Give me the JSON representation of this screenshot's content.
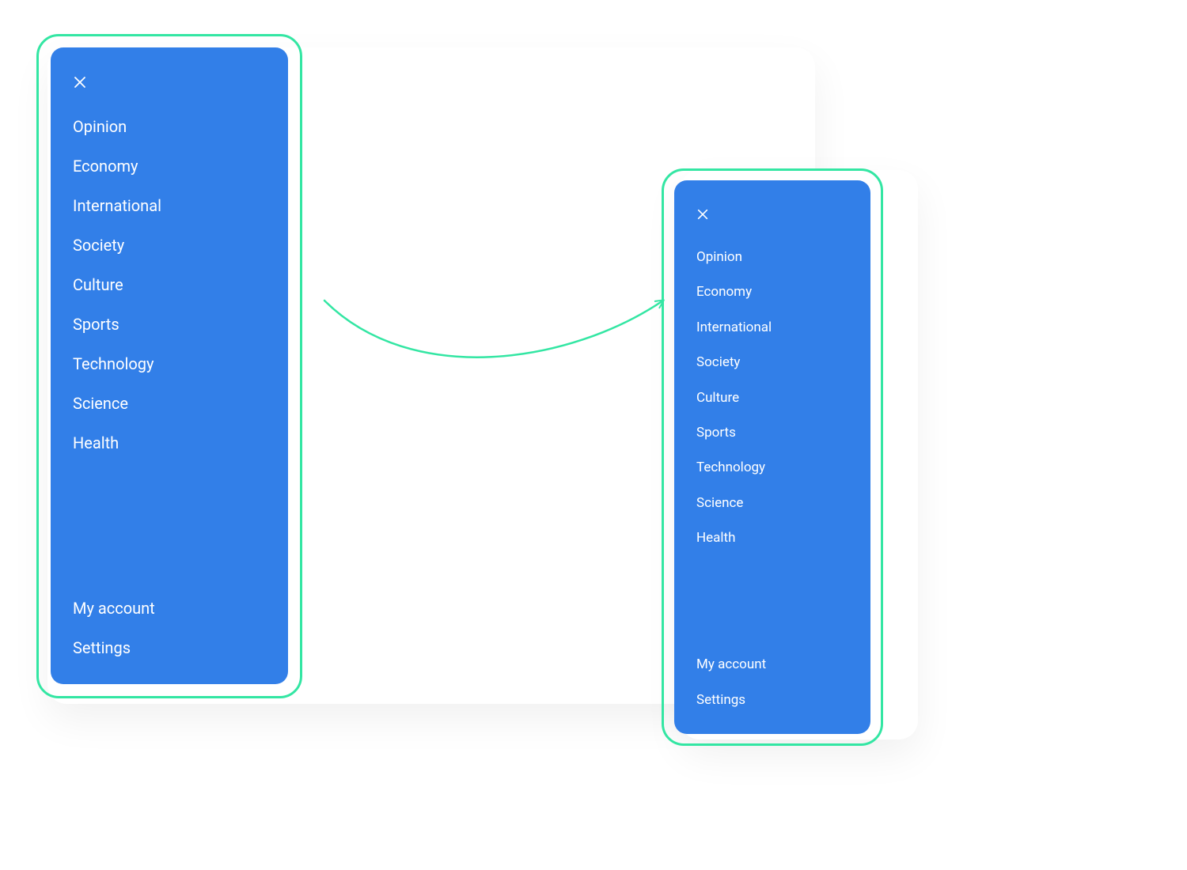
{
  "colors": {
    "drawer_bg": "#327fe8",
    "highlight": "#33e6a3",
    "text": "#ffffff"
  },
  "drawer": {
    "nav_items": [
      "Opinion",
      "Economy",
      "International",
      "Society",
      "Culture",
      "Sports",
      "Technology",
      "Science",
      "Health"
    ],
    "bottom_items": [
      "My account",
      "Settings"
    ]
  }
}
